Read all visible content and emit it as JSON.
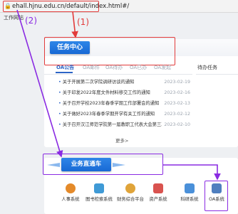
{
  "browser": {
    "url": "ehall.hjnu.edu.cn/default/index.html#/"
  },
  "site": {
    "tab_text": "工作网站"
  },
  "task_center": {
    "title": "任务中心",
    "tabs": [
      "OA公告",
      "OA邮件",
      "OA待办",
      "OA已办",
      "OA发起"
    ],
    "side_title": "待办任务",
    "news": [
      {
        "title": "关于开展第二次学院调研访谈的通知",
        "date": "2023-02-19"
      },
      {
        "title": "关于印发2022年度文件材料移交工作的通知",
        "date": "2023-02-16"
      },
      {
        "title": "关于召开学校2023年春季学期工作部署会的通知",
        "date": "2023-02-13"
      },
      {
        "title": "关于做好2023年春季学期开学有关工作的通知",
        "date": "2023-02-12"
      },
      {
        "title": "关于召开汉江师范学院第一届教职工代表大会第三次会议的通知",
        "date": "2023-02-10"
      }
    ],
    "more": "更多>"
  },
  "business": {
    "title": "业务直通车",
    "apps": [
      {
        "label": "人事系统",
        "icon": "person-icon",
        "color": "#e48a2a"
      },
      {
        "label": "图书检索系统",
        "icon": "book-icon",
        "color": "#3f9ad6"
      },
      {
        "label": "财务综合平台",
        "icon": "finance-icon",
        "color": "#e0a43a"
      },
      {
        "label": "资产系统",
        "icon": "asset-icon",
        "color": "#d9534f"
      },
      {
        "label": "科研系统",
        "icon": "research-icon",
        "color": "#4a90d9"
      },
      {
        "label": "OA系统",
        "icon": "oa-icon",
        "color": "#4f7fbf"
      }
    ]
  },
  "annotations": {
    "step1": "(1)",
    "step2": "(2)"
  },
  "colors": {
    "primary_blue": "#1869d4",
    "highlight_red": "#e23b3b",
    "highlight_purple": "#8a2be2"
  }
}
